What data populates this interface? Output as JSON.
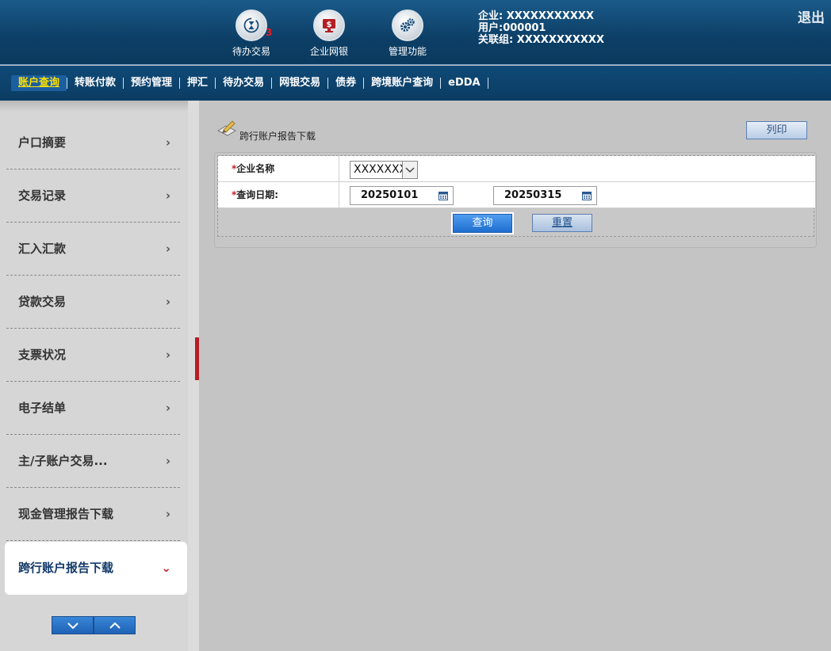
{
  "header": {
    "icons": [
      {
        "label": "待办交易",
        "icon": "hourglass-refresh-icon",
        "badge": "3"
      },
      {
        "label": "企业网银",
        "icon": "monitor-dollar-icon"
      },
      {
        "label": "管理功能",
        "icon": "gears-icon"
      }
    ],
    "user_info": {
      "company": "企业: XXXXXXXXXXX",
      "user": "用户:000001",
      "group": "关联组: XXXXXXXXXXX"
    },
    "logout": "退出"
  },
  "nav": {
    "items": [
      "账户查询",
      "转账付款",
      "预约管理",
      "押汇",
      "待办交易",
      "网银交易",
      "债券",
      "跨境账户查询",
      "eDDA"
    ],
    "active_index": 0
  },
  "sidebar": {
    "items": [
      {
        "label": "户口摘要"
      },
      {
        "label": "交易记录"
      },
      {
        "label": "汇入汇款"
      },
      {
        "label": "贷款交易"
      },
      {
        "label": "支票状况"
      },
      {
        "label": "电子结单"
      },
      {
        "label": "主/子账户交易..."
      },
      {
        "label": "现金管理报告下载"
      },
      {
        "label": "跨行账户报告下载"
      }
    ],
    "active_index": 8
  },
  "main": {
    "title": "跨行账户报告下载",
    "print_label": "列印",
    "form": {
      "company_label": "企业名称",
      "company_value": "XXXXXXX",
      "date_label": "查询日期:",
      "date_from": "20250101",
      "date_to": "20250315",
      "required_mark": "*"
    },
    "query_label": "查询",
    "reset_label": "重置"
  },
  "colors": {
    "header_bg": "#0d3f66",
    "nav_active_text": "#ffe000",
    "accent_red": "#c0212c",
    "button_blue": "#1e6ed0"
  }
}
